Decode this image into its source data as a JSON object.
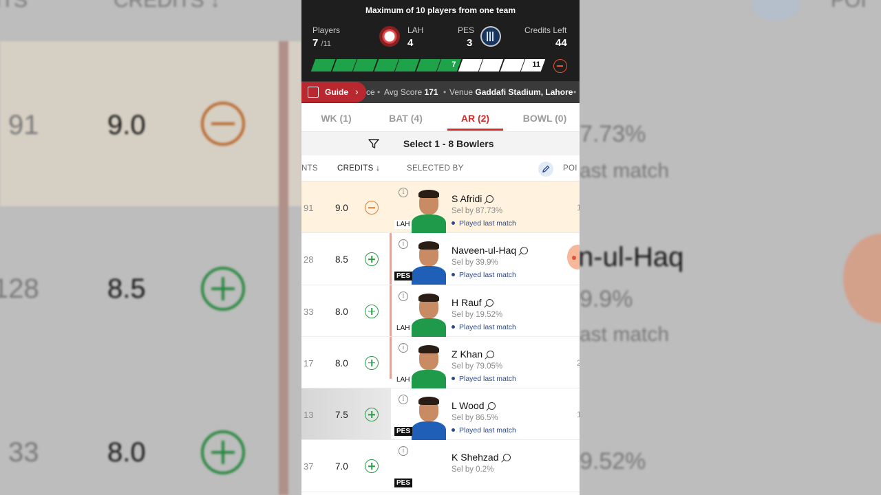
{
  "header": {
    "max_note": "Maximum of 10 players from one team",
    "players_label": "Players",
    "players_count": "7",
    "players_total": "/11",
    "team1_code": "LAH",
    "team1_count": "4",
    "team2_code": "PES",
    "team2_count": "3",
    "credits_label": "Credits Left",
    "credits_left": "44",
    "progress_selected": 7,
    "progress_total": 11,
    "progress_selected_label": "7",
    "progress_total_label": "11"
  },
  "info_strip": {
    "guide_label": "Guide",
    "partial_text": "ce",
    "avg_score_label": "Avg Score",
    "avg_score_value": "171",
    "venue_label": "Venue",
    "venue_value": "Gaddafi Stadium, Lahore"
  },
  "tabs": [
    {
      "label": "WK (1)"
    },
    {
      "label": "BAT (4)"
    },
    {
      "label": "AR (2)"
    },
    {
      "label": "BOWL (0)"
    }
  ],
  "active_tab": "AR (2)",
  "select_bar": {
    "text": "Select 1 - 8 Bowlers"
  },
  "columns": {
    "points_partial": "NTS",
    "credits": "CREDITS ↓",
    "selected_by": "SELECTED BY",
    "points_right": "POI"
  },
  "players": [
    {
      "points": "91",
      "credits": "9.0",
      "selected": true,
      "team": "LAH",
      "name": "S Afridi",
      "sel_by": "Sel by 87.73%",
      "last_match": "Played last match",
      "edge": "1"
    },
    {
      "points": "28",
      "credits": "8.5",
      "selected": false,
      "team": "PES",
      "name": "Naveen-ul-Haq",
      "sel_by": "Sel by 39.9%",
      "last_match": "Played last match",
      "edge": ""
    },
    {
      "points": "33",
      "credits": "8.0",
      "selected": false,
      "team": "LAH",
      "name": "H Rauf",
      "sel_by": "Sel by 19.52%",
      "last_match": "Played last match",
      "edge": ""
    },
    {
      "points": "17",
      "credits": "8.0",
      "selected": false,
      "team": "LAH",
      "name": "Z Khan",
      "sel_by": "Sel by 79.05%",
      "last_match": "Played last match",
      "edge": "2"
    },
    {
      "points": "13",
      "credits": "7.5",
      "selected": false,
      "team": "PES",
      "name": "L Wood",
      "sel_by": "Sel by 86.5%",
      "last_match": "Played last match",
      "edge": "1"
    },
    {
      "points": "37",
      "credits": "7.0",
      "selected": false,
      "team": "PES",
      "name": "K Shehzad",
      "sel_by": "Sel by 0.2%",
      "last_match": "",
      "edge": ""
    }
  ],
  "background_left": {
    "header_partial": "NTS",
    "header_credits": "CREDITS ↓",
    "rows": [
      {
        "points": "91",
        "credits": "9.0"
      },
      {
        "points": "128",
        "credits": "8.5"
      },
      {
        "points": "33",
        "credits": "8.0"
      }
    ]
  },
  "background_right": {
    "header_partial": "POI",
    "texts": [
      "7.73%",
      "ast match",
      "n-ul-Haq",
      "9.9%",
      "ast match",
      "9.52%"
    ]
  },
  "colors": {
    "accent_red": "#d42a2a",
    "add_green": "#2a9b48",
    "remove_orange": "#e07a30",
    "progress_green": "#1fa34a",
    "header_dark": "#1e1e1e"
  }
}
